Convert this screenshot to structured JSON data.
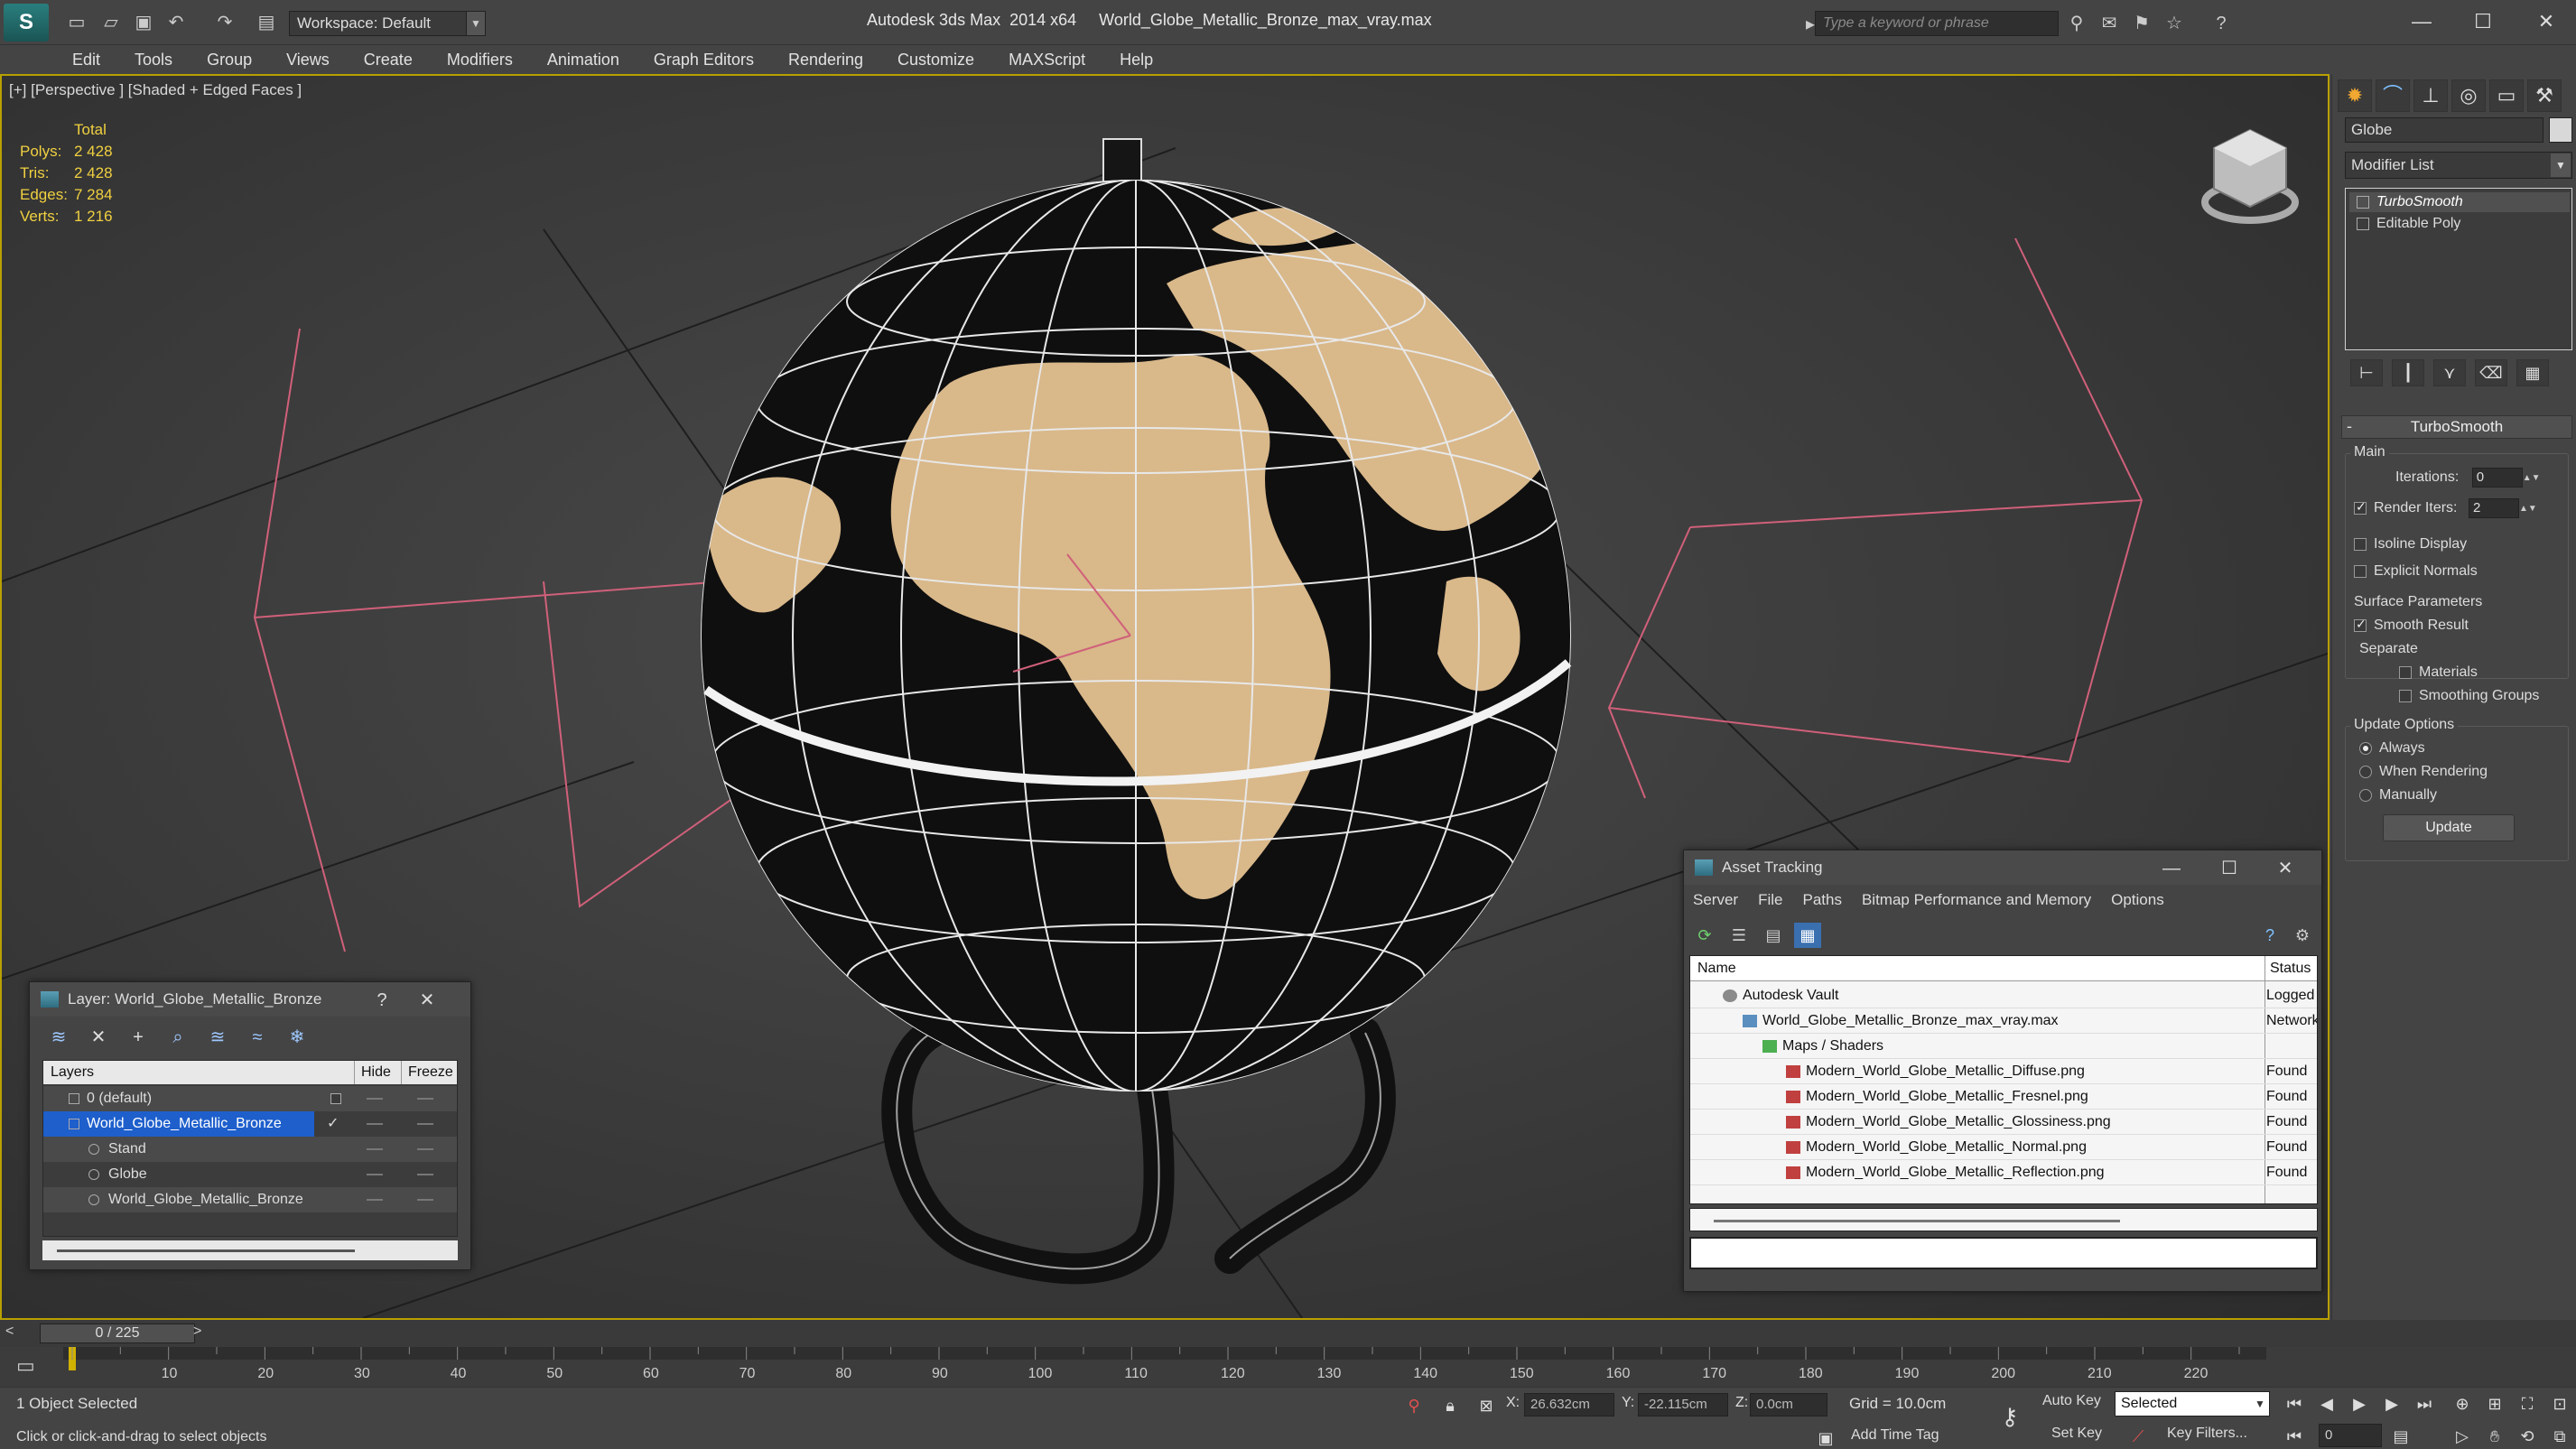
{
  "titlebar": {
    "workspace": "Workspace: Default",
    "title": "Autodesk 3ds Max  2014 x64     World_Globe_Metallic_Bronze_max_vray.max",
    "search_placeholder": "Type a keyword or phrase",
    "app_logo_glyph": "S",
    "help_glyph": "?"
  },
  "menubar": [
    "Edit",
    "Tools",
    "Group",
    "Views",
    "Create",
    "Modifiers",
    "Animation",
    "Graph Editors",
    "Rendering",
    "Customize",
    "MAXScript",
    "Help"
  ],
  "viewport": {
    "label": "[+] [Perspective ] [Shaded + Edged Faces ]",
    "stats_header": "Total",
    "stats": [
      {
        "label": "Polys:",
        "value": "2 428"
      },
      {
        "label": "Tris:",
        "value": "2 428"
      },
      {
        "label": "Edges:",
        "value": "7 284"
      },
      {
        "label": "Verts:",
        "value": "1 216"
      }
    ]
  },
  "command_panel": {
    "object_name": "Globe",
    "modifier_list": "Modifier List",
    "stack": [
      "TurboSmooth",
      "Editable Poly"
    ],
    "rollout_title": "TurboSmooth",
    "main_group": "Main",
    "iterations_label": "Iterations:",
    "iterations_value": "0",
    "render_iters_label": "Render Iters:",
    "render_iters_value": "2",
    "isoline_label": "Isoline Display",
    "explicit_normals_label": "Explicit Normals",
    "surface_group": "Surface Parameters",
    "smooth_result_label": "Smooth Result",
    "separate_label": "Separate",
    "materials_label": "Materials",
    "smoothing_groups_label": "Smoothing Groups",
    "update_group": "Update Options",
    "always_label": "Always",
    "when_rendering_label": "When Rendering",
    "manually_label": "Manually",
    "update_button": "Update"
  },
  "layer_window": {
    "title": "Layer: World_Globe_Metallic_Bronze",
    "help": "?",
    "columns": {
      "layers": "Layers",
      "hide": "Hide",
      "freeze": "Freeze"
    },
    "rows": [
      {
        "name": "0 (default)",
        "indent": 1
      },
      {
        "name": "World_Globe_Metallic_Bronze",
        "indent": 1
      },
      {
        "name": "Stand",
        "indent": 2
      },
      {
        "name": "Globe",
        "indent": 2
      },
      {
        "name": "World_Globe_Metallic_Bronze",
        "indent": 2
      }
    ]
  },
  "asset_window": {
    "title": "Asset Tracking",
    "menu": [
      "Server",
      "File",
      "Paths",
      "Bitmap Performance and Memory",
      "Options"
    ],
    "columns": {
      "name": "Name",
      "status": "Status"
    },
    "rows": [
      {
        "name": "Autodesk Vault",
        "status": "Logged O",
        "indent": 1,
        "icon": "vault-icon"
      },
      {
        "name": "World_Globe_Metallic_Bronze_max_vray.max",
        "status": "Network",
        "indent": 2,
        "icon": "max-file-icon"
      },
      {
        "name": "Maps / Shaders",
        "status": "",
        "indent": 3,
        "icon": "maps-folder-icon"
      },
      {
        "name": "Modern_World_Globe_Metallic_Diffuse.png",
        "status": "Found",
        "indent": 4,
        "icon": "png-file-icon"
      },
      {
        "name": "Modern_World_Globe_Metallic_Fresnel.png",
        "status": "Found",
        "indent": 4,
        "icon": "png-file-icon"
      },
      {
        "name": "Modern_World_Globe_Metallic_Glossiness.png",
        "status": "Found",
        "indent": 4,
        "icon": "png-file-icon"
      },
      {
        "name": "Modern_World_Globe_Metallic_Normal.png",
        "status": "Found",
        "indent": 4,
        "icon": "png-file-icon"
      },
      {
        "name": "Modern_World_Globe_Metallic_Reflection.png",
        "status": "Found",
        "indent": 4,
        "icon": "png-file-icon"
      }
    ]
  },
  "timeline": {
    "frame_display": "0 / 225",
    "prev": "<",
    "next": ">",
    "ticks": [
      "10",
      "20",
      "30",
      "40",
      "50",
      "60",
      "70",
      "80",
      "90",
      "100",
      "110",
      "120",
      "130",
      "140",
      "150",
      "160",
      "170",
      "180",
      "190",
      "200",
      "210",
      "220"
    ]
  },
  "statusbar": {
    "selection": "1 Object Selected",
    "prompt": "Click or click-and-drag to select objects",
    "x_label": "X:",
    "x_value": "26.632cm",
    "y_label": "Y:",
    "y_value": "-22.115cm",
    "z_label": "Z:",
    "z_value": "0.0cm",
    "grid": "Grid = 10.0cm",
    "add_time_tag": "Add Time Tag",
    "auto_key": "Auto Key",
    "set_key": "Set Key",
    "selected": "Selected",
    "key_filters": "Key Filters...",
    "frame": "0"
  },
  "colors": {
    "accent": "#b8a000",
    "stats": "#f0d040",
    "selection": "#1e5fcc",
    "globe_land": "#d9b88a",
    "helper_pink": "#d0607a"
  }
}
